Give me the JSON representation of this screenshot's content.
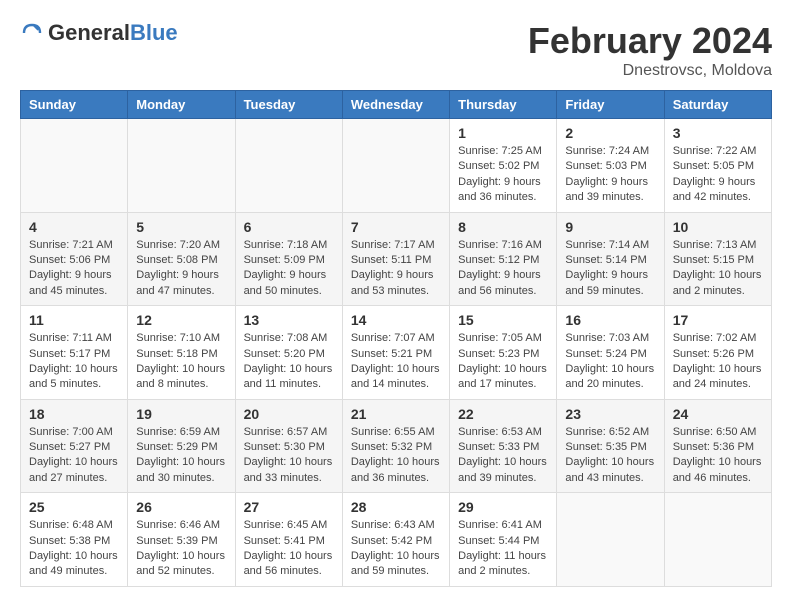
{
  "header": {
    "logo_general": "General",
    "logo_blue": "Blue",
    "main_title": "February 2024",
    "subtitle": "Dnestrovsc, Moldova"
  },
  "calendar": {
    "days_of_week": [
      "Sunday",
      "Monday",
      "Tuesday",
      "Wednesday",
      "Thursday",
      "Friday",
      "Saturday"
    ],
    "weeks": [
      [
        {
          "day": "",
          "info": ""
        },
        {
          "day": "",
          "info": ""
        },
        {
          "day": "",
          "info": ""
        },
        {
          "day": "",
          "info": ""
        },
        {
          "day": "1",
          "info": "Sunrise: 7:25 AM\nSunset: 5:02 PM\nDaylight: 9 hours and 36 minutes."
        },
        {
          "day": "2",
          "info": "Sunrise: 7:24 AM\nSunset: 5:03 PM\nDaylight: 9 hours and 39 minutes."
        },
        {
          "day": "3",
          "info": "Sunrise: 7:22 AM\nSunset: 5:05 PM\nDaylight: 9 hours and 42 minutes."
        }
      ],
      [
        {
          "day": "4",
          "info": "Sunrise: 7:21 AM\nSunset: 5:06 PM\nDaylight: 9 hours and 45 minutes."
        },
        {
          "day": "5",
          "info": "Sunrise: 7:20 AM\nSunset: 5:08 PM\nDaylight: 9 hours and 47 minutes."
        },
        {
          "day": "6",
          "info": "Sunrise: 7:18 AM\nSunset: 5:09 PM\nDaylight: 9 hours and 50 minutes."
        },
        {
          "day": "7",
          "info": "Sunrise: 7:17 AM\nSunset: 5:11 PM\nDaylight: 9 hours and 53 minutes."
        },
        {
          "day": "8",
          "info": "Sunrise: 7:16 AM\nSunset: 5:12 PM\nDaylight: 9 hours and 56 minutes."
        },
        {
          "day": "9",
          "info": "Sunrise: 7:14 AM\nSunset: 5:14 PM\nDaylight: 9 hours and 59 minutes."
        },
        {
          "day": "10",
          "info": "Sunrise: 7:13 AM\nSunset: 5:15 PM\nDaylight: 10 hours and 2 minutes."
        }
      ],
      [
        {
          "day": "11",
          "info": "Sunrise: 7:11 AM\nSunset: 5:17 PM\nDaylight: 10 hours and 5 minutes."
        },
        {
          "day": "12",
          "info": "Sunrise: 7:10 AM\nSunset: 5:18 PM\nDaylight: 10 hours and 8 minutes."
        },
        {
          "day": "13",
          "info": "Sunrise: 7:08 AM\nSunset: 5:20 PM\nDaylight: 10 hours and 11 minutes."
        },
        {
          "day": "14",
          "info": "Sunrise: 7:07 AM\nSunset: 5:21 PM\nDaylight: 10 hours and 14 minutes."
        },
        {
          "day": "15",
          "info": "Sunrise: 7:05 AM\nSunset: 5:23 PM\nDaylight: 10 hours and 17 minutes."
        },
        {
          "day": "16",
          "info": "Sunrise: 7:03 AM\nSunset: 5:24 PM\nDaylight: 10 hours and 20 minutes."
        },
        {
          "day": "17",
          "info": "Sunrise: 7:02 AM\nSunset: 5:26 PM\nDaylight: 10 hours and 24 minutes."
        }
      ],
      [
        {
          "day": "18",
          "info": "Sunrise: 7:00 AM\nSunset: 5:27 PM\nDaylight: 10 hours and 27 minutes."
        },
        {
          "day": "19",
          "info": "Sunrise: 6:59 AM\nSunset: 5:29 PM\nDaylight: 10 hours and 30 minutes."
        },
        {
          "day": "20",
          "info": "Sunrise: 6:57 AM\nSunset: 5:30 PM\nDaylight: 10 hours and 33 minutes."
        },
        {
          "day": "21",
          "info": "Sunrise: 6:55 AM\nSunset: 5:32 PM\nDaylight: 10 hours and 36 minutes."
        },
        {
          "day": "22",
          "info": "Sunrise: 6:53 AM\nSunset: 5:33 PM\nDaylight: 10 hours and 39 minutes."
        },
        {
          "day": "23",
          "info": "Sunrise: 6:52 AM\nSunset: 5:35 PM\nDaylight: 10 hours and 43 minutes."
        },
        {
          "day": "24",
          "info": "Sunrise: 6:50 AM\nSunset: 5:36 PM\nDaylight: 10 hours and 46 minutes."
        }
      ],
      [
        {
          "day": "25",
          "info": "Sunrise: 6:48 AM\nSunset: 5:38 PM\nDaylight: 10 hours and 49 minutes."
        },
        {
          "day": "26",
          "info": "Sunrise: 6:46 AM\nSunset: 5:39 PM\nDaylight: 10 hours and 52 minutes."
        },
        {
          "day": "27",
          "info": "Sunrise: 6:45 AM\nSunset: 5:41 PM\nDaylight: 10 hours and 56 minutes."
        },
        {
          "day": "28",
          "info": "Sunrise: 6:43 AM\nSunset: 5:42 PM\nDaylight: 10 hours and 59 minutes."
        },
        {
          "day": "29",
          "info": "Sunrise: 6:41 AM\nSunset: 5:44 PM\nDaylight: 11 hours and 2 minutes."
        },
        {
          "day": "",
          "info": ""
        },
        {
          "day": "",
          "info": ""
        }
      ]
    ]
  }
}
